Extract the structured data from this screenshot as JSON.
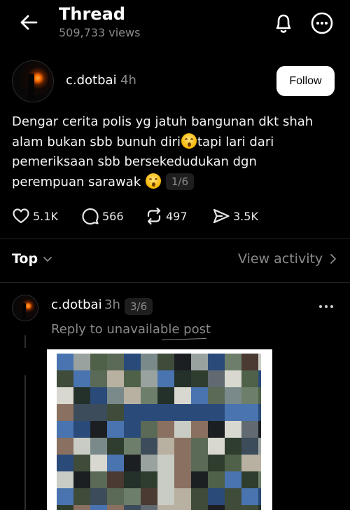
{
  "header": {
    "title": "Thread",
    "views": "509,733 views"
  },
  "post": {
    "username": "c.dotbai",
    "time": "4h",
    "follow_label": "Follow",
    "text_lines": [
      "Dengar cerita polis yg jatuh bangunan dkt shah",
      "alam bukan sbb bunuh diri",
      "tapi lari dari",
      "pemeriksaan sbb bersekedudukan dgn",
      "perempuan sarawak"
    ],
    "page_indicator": "1/6",
    "stats": {
      "likes": "5.1K",
      "replies": "566",
      "reposts": "497",
      "shares": "3.5K"
    }
  },
  "sort": {
    "label": "Top",
    "view_activity": "View activity"
  },
  "reply": {
    "username": "c.dotbai",
    "time": "3h",
    "page_indicator": "3/6",
    "reply_to": "Reply to unavailable post"
  },
  "colors": {
    "background": "#000000",
    "text_primary": "#f3f5f7",
    "text_secondary": "#8a8a8a",
    "divider": "#262626",
    "follow_bg": "#ffffff"
  },
  "icons": [
    "back-arrow-icon",
    "bell-icon",
    "more-circle-icon",
    "heart-icon",
    "comment-icon",
    "repost-icon",
    "share-icon",
    "chevron-down-icon",
    "chevron-right-icon",
    "more-dots-icon"
  ]
}
